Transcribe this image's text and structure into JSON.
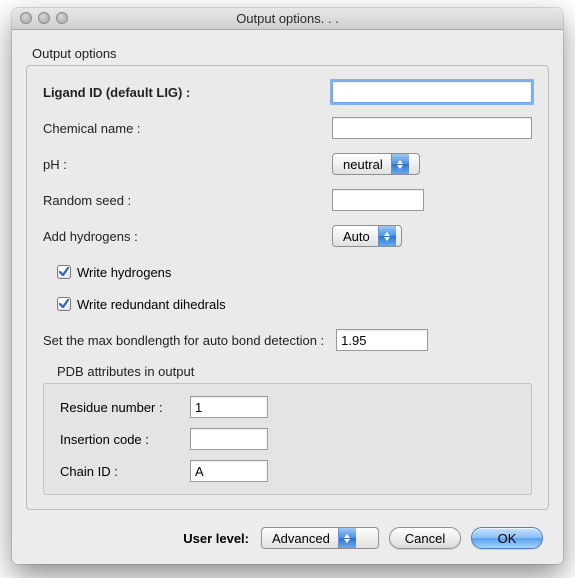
{
  "window": {
    "title": "Output options. . ."
  },
  "group": {
    "title": "Output options",
    "ligand_label": "Ligand ID (default LIG) :",
    "ligand_value": "",
    "chemical_label": "Chemical name :",
    "chemical_value": "",
    "ph_label": "pH :",
    "ph_value": "neutral",
    "seed_label": "Random seed :",
    "seed_value": "",
    "addh_label": "Add hydrogens :",
    "addh_value": "Auto",
    "cb_write_h": "Write hydrogens",
    "cb_write_dih": "Write redundant dihedrals",
    "maxbond_label": "Set the max bondlength for auto bond detection :",
    "maxbond_value": "1.95",
    "pdb": {
      "title": "PDB attributes in output",
      "resnum_label": "Residue number :",
      "resnum_value": "1",
      "inscode_label": "Insertion code :",
      "inscode_value": "",
      "chain_label": "Chain ID :",
      "chain_value": "A"
    }
  },
  "footer": {
    "level_label": "User level:",
    "level_value": "Advanced",
    "cancel": "Cancel",
    "ok": "OK"
  }
}
